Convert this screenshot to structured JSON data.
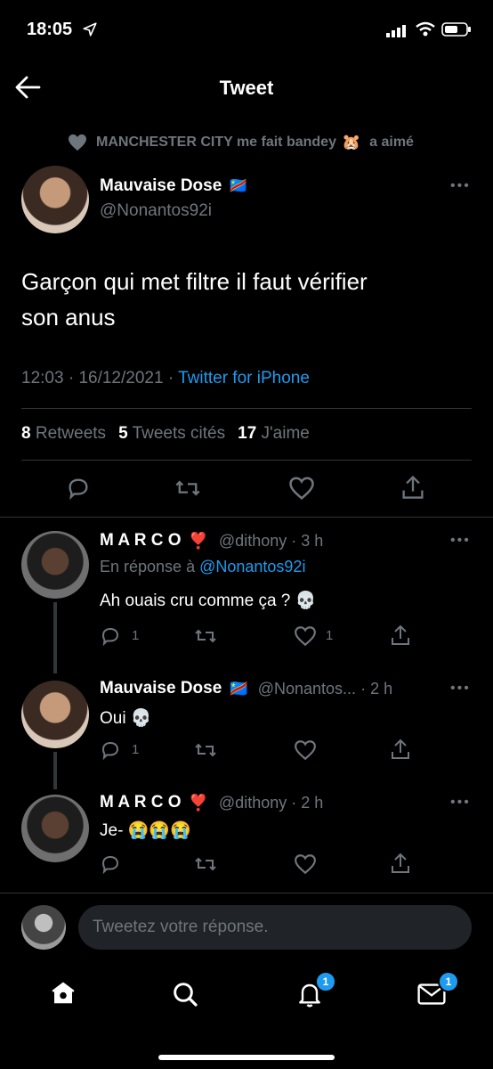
{
  "status_bar": {
    "time": "18:05"
  },
  "header": {
    "title": "Tweet"
  },
  "social_context": {
    "name": "MANCHESTER CITY me fait bandey",
    "emoji": "🐹",
    "action": "a aimé"
  },
  "main_tweet": {
    "display_name": "Mauvaise Dose",
    "flag": "🇨🇩",
    "handle": "@Nonantos92i",
    "text_line1": "Garçon qui met filtre il faut vérifier",
    "text_line2": "son anus",
    "time": "12:03",
    "date": "16/12/2021",
    "source": "Twitter for iPhone",
    "retweets_count": "8",
    "retweets_label": "Retweets",
    "quotes_count": "5",
    "quotes_label": "Tweets cités",
    "likes_count": "17",
    "likes_label": "J'aime"
  },
  "replies": [
    {
      "display_name": "M A R C O",
      "heart": "❣️",
      "handle": "@dithony",
      "time": "3 h",
      "reply_prefix": "En réponse à",
      "reply_to": "@Nonantos92i",
      "text": "Ah ouais cru comme ça ?",
      "emoji": "💀",
      "reply_count": "1",
      "like_count": "1"
    },
    {
      "display_name": "Mauvaise Dose",
      "flag": "🇨🇩",
      "handle": "@Nonantos...",
      "time": "2 h",
      "text": "Oui",
      "emoji": "💀",
      "reply_count": "1"
    },
    {
      "display_name": "M A R C O",
      "heart": "❣️",
      "handle": "@dithony",
      "time": "2 h",
      "text": "Je-",
      "emoji": "😭😭😭"
    }
  ],
  "compose": {
    "placeholder": "Tweetez votre réponse."
  },
  "tab_bar": {
    "notifications_badge": "1",
    "messages_badge": "1"
  },
  "colors": {
    "accent": "#1d9bf0",
    "muted": "#6e767d",
    "background": "#000000"
  }
}
